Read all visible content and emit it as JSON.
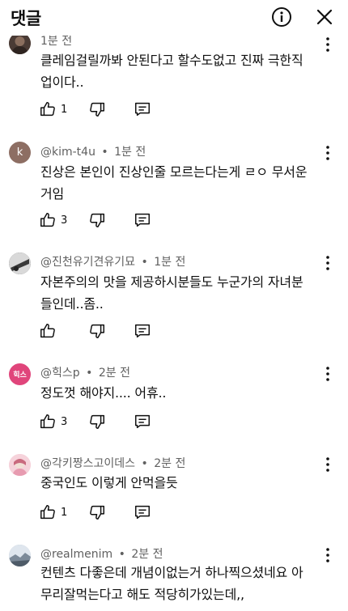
{
  "header": {
    "title": "댓글",
    "info_icon": "info-circle-icon",
    "close_icon": "close-icon"
  },
  "comments": [
    {
      "author": "",
      "time": "1분 전",
      "text_lines": [
        "클레임걸릴까봐 안된다고 할수도없고 진짜 극한직",
        "업이다.."
      ],
      "likes": "1",
      "avatar_letter": "",
      "avatar_color": "#5b4a42"
    },
    {
      "author": "@kim-t4u",
      "time": "1분 전",
      "text_lines": [
        "진상은 본인이 진상인줄 모르는다는게 ㄹㅇ 무서운",
        "거임"
      ],
      "likes": "3",
      "avatar_letter": "k",
      "avatar_color": "#8d6e63"
    },
    {
      "author": "@진천유기견유기묘",
      "time": "1분 전",
      "text_lines": [
        "자본주의의 맛을 제공하시분들도 누군가의 자녀분",
        "들인데..좀.."
      ],
      "likes": "",
      "avatar_letter": "",
      "avatar_color": "#6f6f6f"
    },
    {
      "author": "@힉스p",
      "time": "2분 전",
      "text_lines": [
        "정도껏 해야지.... 어휴.."
      ],
      "likes": "3",
      "avatar_letter": "힉스",
      "avatar_color": "#e0457b"
    },
    {
      "author": "@각키짱스고이데스",
      "time": "2분 전",
      "text_lines": [
        "중국인도 이렇게 안먹을듯"
      ],
      "likes": "1",
      "avatar_letter": "",
      "avatar_color": "#f3c6d0"
    },
    {
      "author": "@realmenim",
      "time": "2분 전",
      "text_lines": [
        "컨텐츠 다좋은데 개념이없는거 하나찍으셨네요 아",
        "무리잘먹는다고 해도 적당히가있는데,,"
      ],
      "likes": "",
      "avatar_letter": "",
      "avatar_color": "#b9c4cf"
    }
  ],
  "icons": {
    "like": "thumbs-up-icon",
    "dislike": "thumbs-down-icon",
    "reply": "reply-icon",
    "menu": "more-vertical-icon"
  }
}
